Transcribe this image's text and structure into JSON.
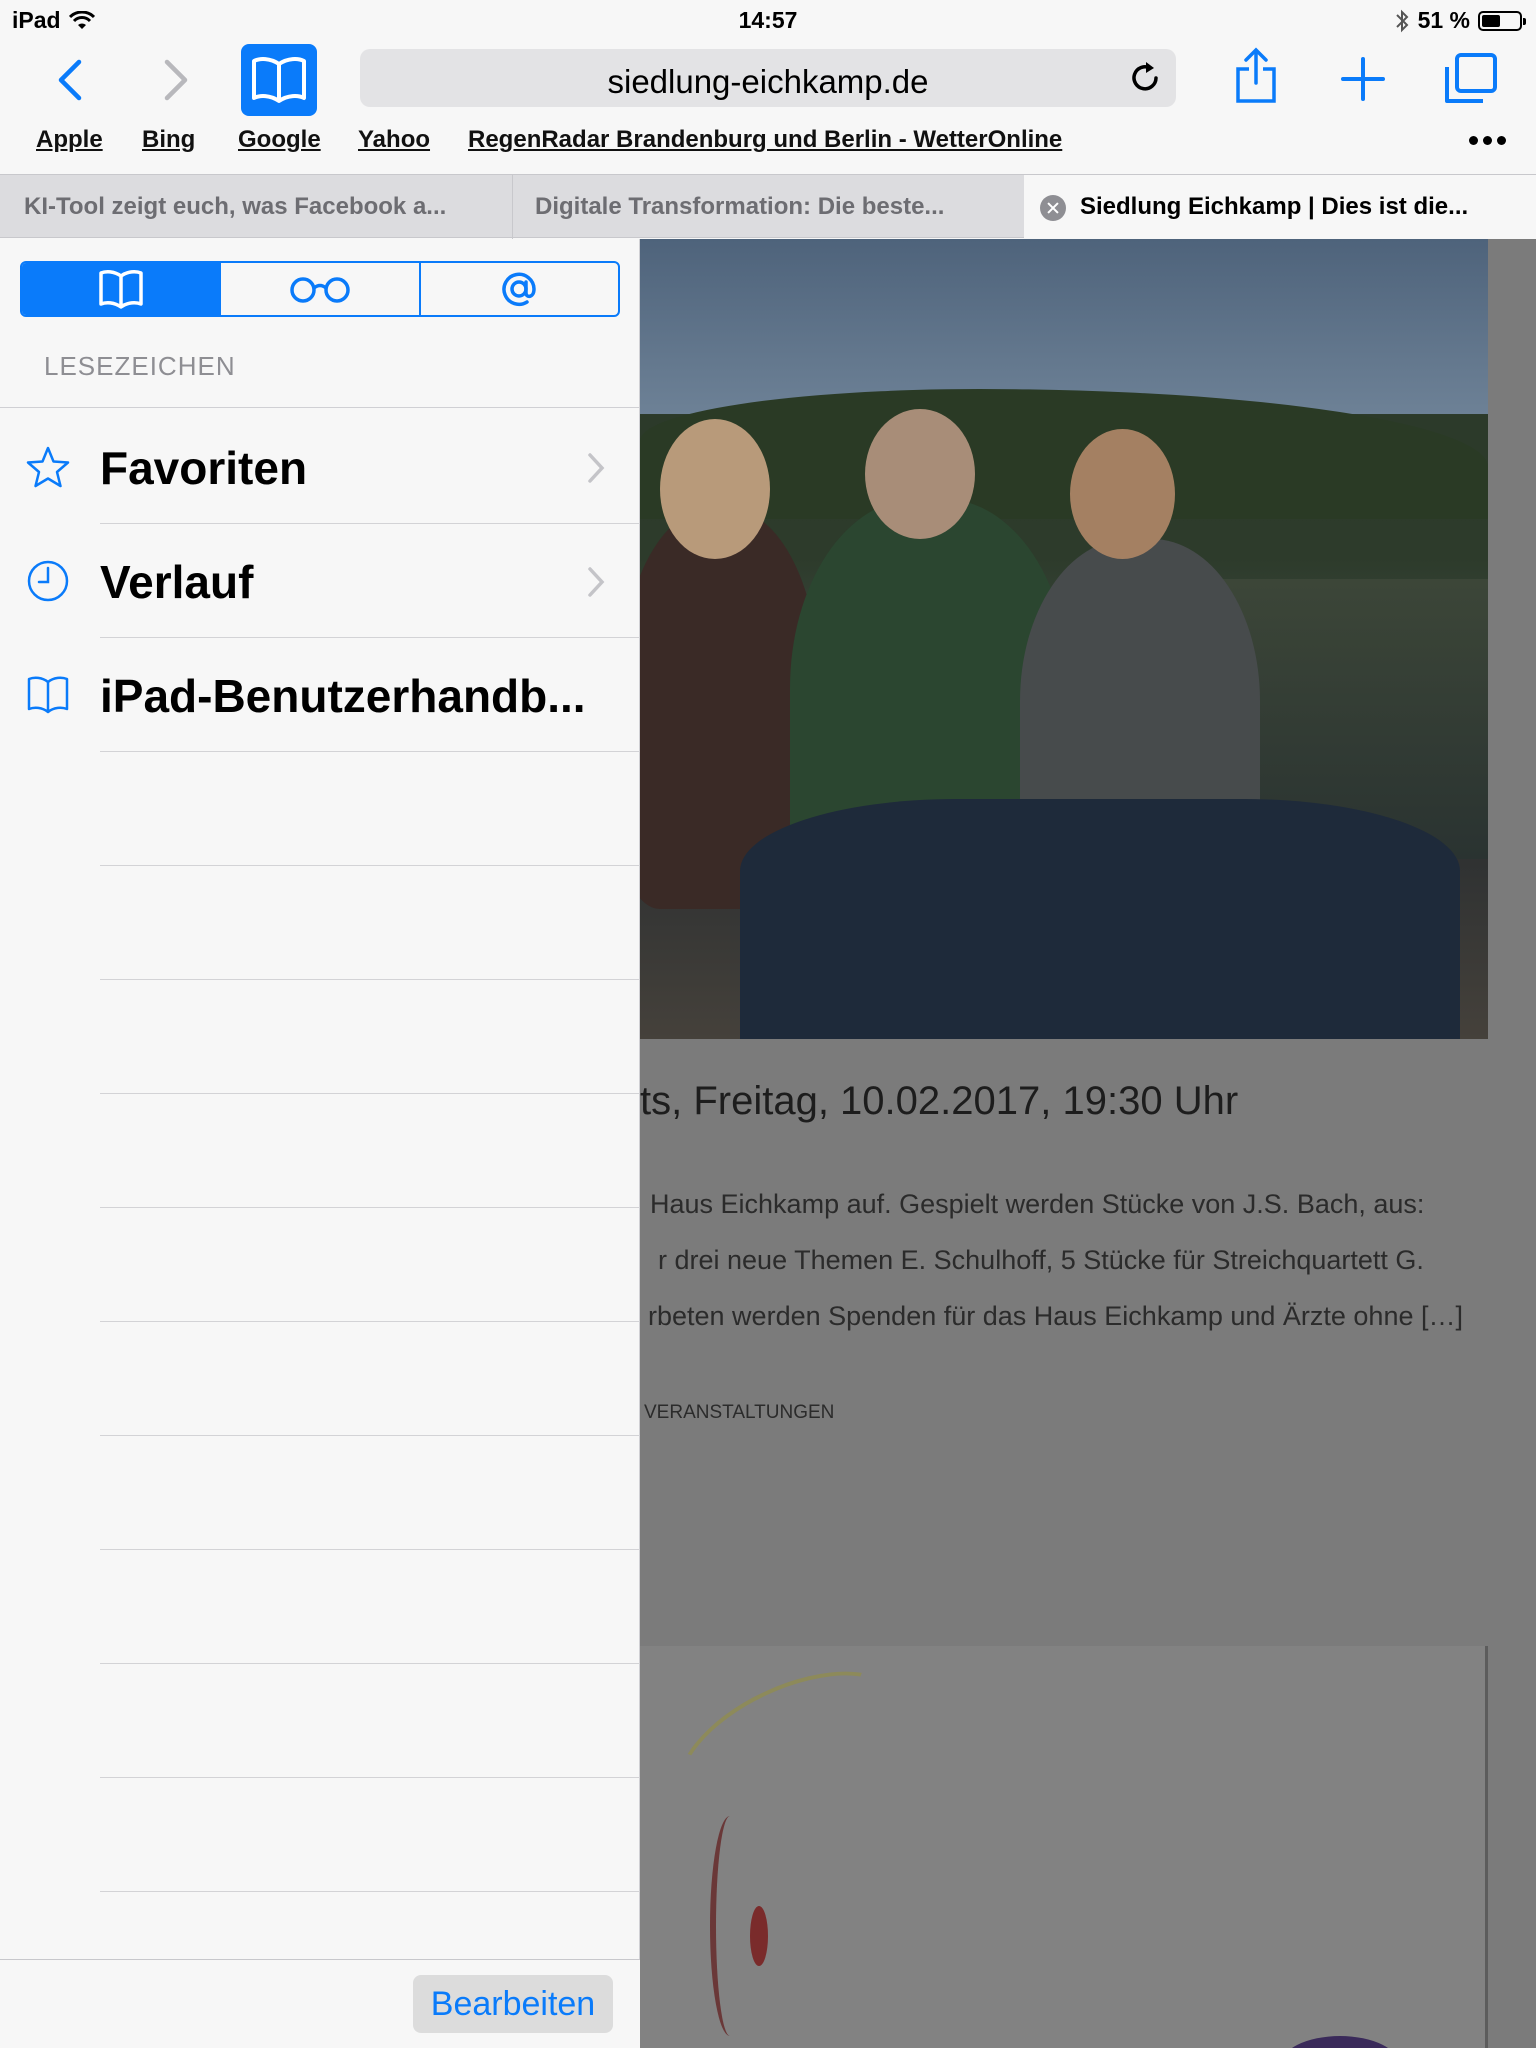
{
  "status_bar": {
    "carrier": "iPad",
    "time": "14:57",
    "battery": "51 %",
    "battery_level": 0.51
  },
  "toolbar": {
    "url": "siedlung-eichkamp.de",
    "back_icon": "chevron-left-icon",
    "forward_icon": "chevron-right-icon",
    "bookmarks_icon": "book-icon",
    "reload_icon": "reload-icon",
    "share_icon": "share-icon",
    "add_icon": "plus-icon",
    "tabs_icon": "tabs-icon"
  },
  "favorites_bar": {
    "items": [
      "Apple",
      "Bing",
      "Google",
      "Yahoo",
      "RegenRadar Brandenburg und Berlin - WetterOnline"
    ]
  },
  "tabs": [
    {
      "title": "KI-Tool zeigt euch, was Facebook a..."
    },
    {
      "title": "Digitale Transformation: Die beste..."
    },
    {
      "title": "Siedlung Eichkamp | Dies ist die..."
    }
  ],
  "sidebar": {
    "segments": [
      "book-icon",
      "glasses-icon",
      "at-icon"
    ],
    "section_title": "LESEZEICHEN",
    "items": [
      {
        "label": "Favoriten",
        "icon": "star-icon",
        "has_chevron": true
      },
      {
        "label": "Verlauf",
        "icon": "clock-icon",
        "has_chevron": true
      },
      {
        "label": "iPad-Benutzerhandb...",
        "icon": "book-icon",
        "has_chevron": false
      }
    ],
    "edit_label": "Bearbeiten"
  },
  "webpage": {
    "title": "ts, Freitag, 10.02.2017, 19:30 Uhr",
    "lines": [
      "Haus Eichkamp auf. Gespielt werden Stücke von J.S. Bach, aus:",
      "r drei neue Themen E. Schulhoff, 5 Stücke für Streichquartett G.",
      "rbeten werden Spenden für das Haus Eichkamp und Ärzte ohne […]"
    ],
    "category": "VERANSTALTUNGEN"
  },
  "colors": {
    "accent": "#0a7bfa",
    "background": "#f7f7f7",
    "dim_overlay": "#7b7b7b"
  }
}
